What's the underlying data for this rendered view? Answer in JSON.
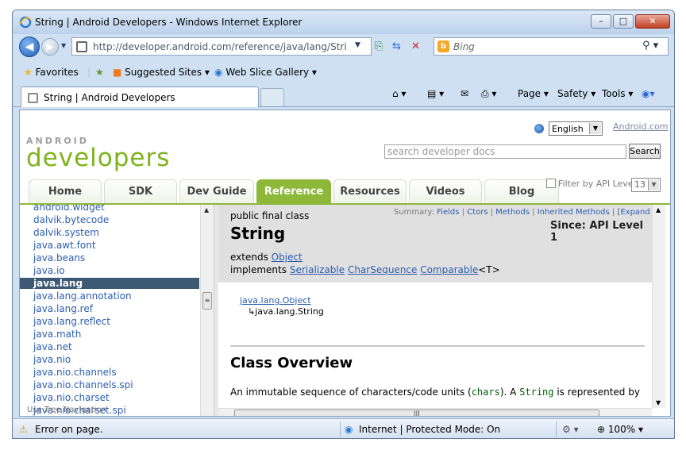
{
  "window": {
    "title": "String | Android Developers - Windows Internet Explorer",
    "minimize": "–",
    "maximize": "□",
    "close": "✕"
  },
  "nav": {
    "address": "http://developer.android.com/reference/java/lang/String.ht",
    "search_placeholder": "Bing"
  },
  "favorites_bar": {
    "favorites": "Favorites",
    "suggested_sites": "Suggested Sites ▾",
    "web_slice_gallery": "Web Slice Gallery ▾"
  },
  "tabs": [
    {
      "label": "String | Android Developers"
    }
  ],
  "command_bar": {
    "page": "Page ▾",
    "safety": "Safety ▾",
    "tools": "Tools ▾"
  },
  "site": {
    "logo_top": "ANDROID",
    "logo_main": "developers",
    "language": "English",
    "android_com": "Android.com",
    "search_placeholder": "search developer docs",
    "search_button": "Search",
    "api_filter_label": "Filter by API Level:",
    "api_level": "13",
    "nav_tabs": [
      "Home",
      "SDK",
      "Dev Guide",
      "Reference",
      "Resources",
      "Videos",
      "Blog"
    ],
    "active_tab": "Reference"
  },
  "packages": [
    "android.widget",
    "dalvik.bytecode",
    "dalvik.system",
    "java.awt.font",
    "java.beans",
    "java.io",
    "java.lang",
    "java.lang.annotation",
    "java.lang.ref",
    "java.lang.reflect",
    "java.math",
    "java.net",
    "java.nio",
    "java.nio.channels",
    "java.nio.channels.spi",
    "java.nio.charset",
    "java.nio.charset.spi"
  ],
  "selected_package": "java.lang",
  "left_footer_overlap": "Use Tree Navigation",
  "class": {
    "modifiers": "public final class",
    "name": "String",
    "summary_label": "Summary:",
    "summary_links": [
      "Fields",
      "Ctors",
      "Methods",
      "Inherited Methods",
      "[Expand All]"
    ],
    "since": "Since: API Level 1",
    "extends_label": "extends",
    "extends": "Object",
    "implements_label": "implements",
    "implements": [
      "Serializable",
      "CharSequence",
      "Comparable"
    ],
    "generic": "<T>",
    "hierarchy": [
      "java.lang.Object",
      "↳java.lang.String"
    ],
    "overview_title": "Class Overview",
    "overview_start": "An immutable sequence of characters/code units (",
    "overview_code1": "chars",
    "overview_mid": "). A ",
    "overview_code2": "String",
    "overview_end": " is represented by"
  },
  "status": {
    "error": "Error on page.",
    "zone": "Internet | Protected Mode: On",
    "zoom": "100%"
  }
}
